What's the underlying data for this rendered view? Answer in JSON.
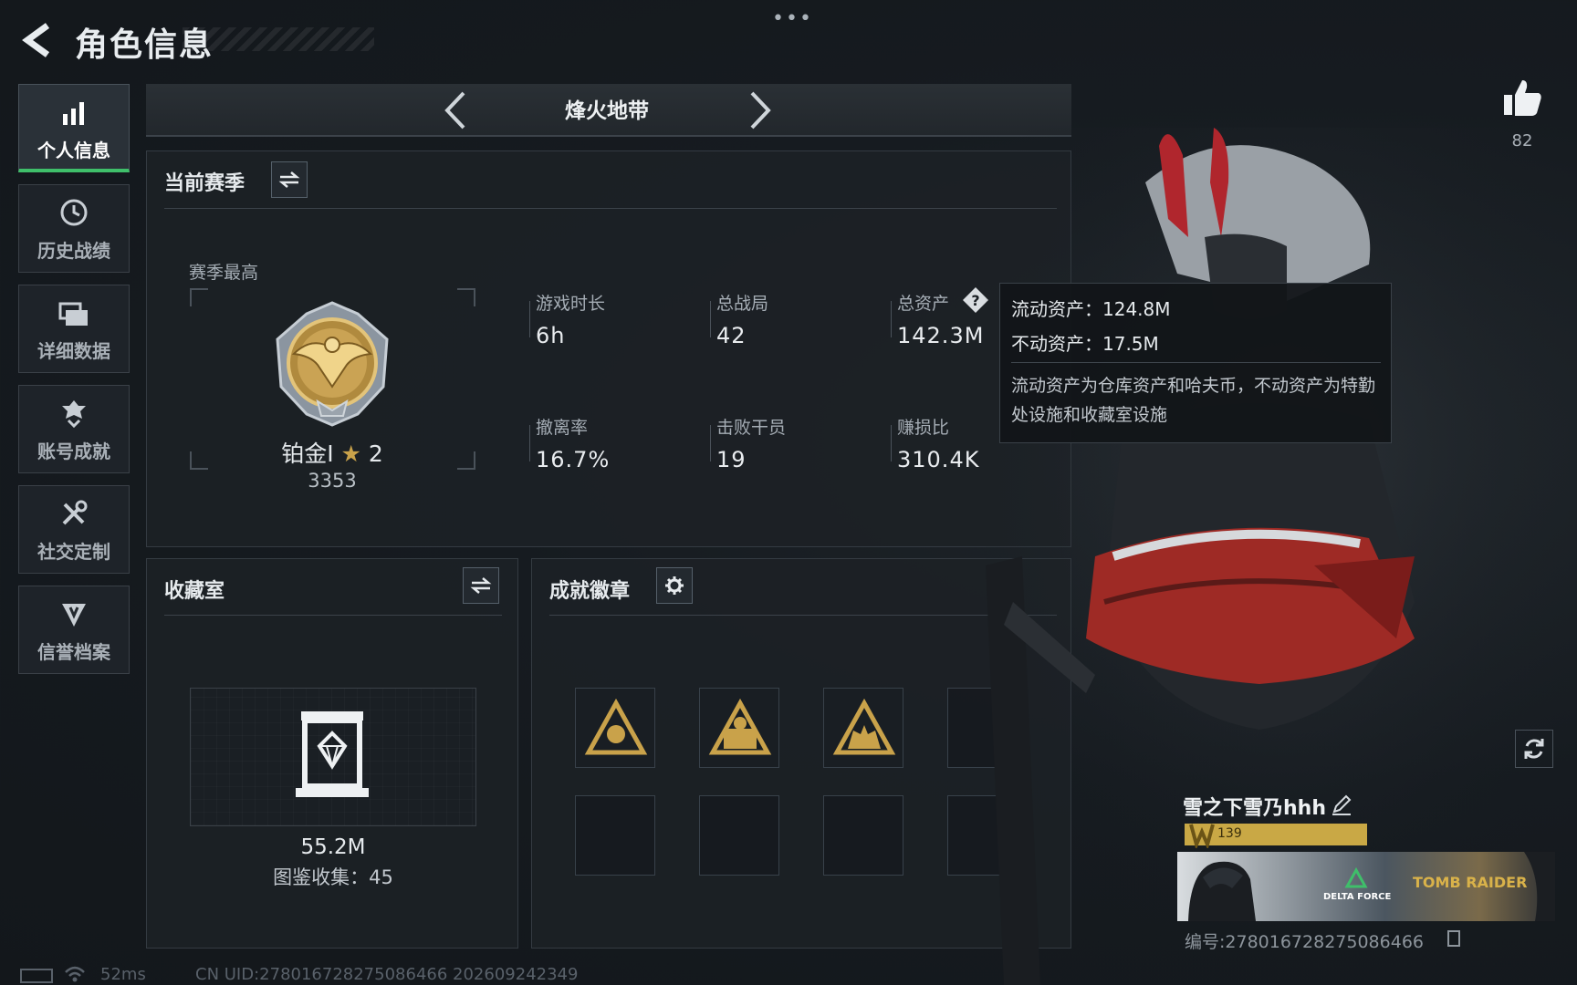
{
  "header": {
    "title": "角色信息",
    "more_label": "•••"
  },
  "sidebar": {
    "items": [
      {
        "label": "个人信息",
        "icon": "bar-chart-icon",
        "active": true
      },
      {
        "label": "历史战绩",
        "icon": "clock-history-icon",
        "active": false
      },
      {
        "label": "详细数据",
        "icon": "folder-icon",
        "active": false
      },
      {
        "label": "账号成就",
        "icon": "medal-icon",
        "active": false
      },
      {
        "label": "社交定制",
        "icon": "tools-icon",
        "active": false
      },
      {
        "label": "信誉档案",
        "icon": "shield-icon",
        "active": false
      }
    ]
  },
  "mode": {
    "title": "烽火地带"
  },
  "season": {
    "title": "当前赛季",
    "best_label": "赛季最高",
    "rank_name": "铂金Ⅰ",
    "rank_stars": "2",
    "rank_score": "3353",
    "stats": [
      {
        "label": "游戏时长",
        "value": "6h"
      },
      {
        "label": "总战局",
        "value": "42"
      },
      {
        "label": "总资产",
        "value": "142.3M"
      },
      {
        "label": "撤离率",
        "value": "16.7%"
      },
      {
        "label": "击败干员",
        "value": "19"
      },
      {
        "label": "赚损比",
        "value": "310.4K"
      }
    ]
  },
  "tooltip": {
    "liquid": "流动资产：124.8M",
    "fixed": "不动资产：17.5M",
    "description": "流动资产为仓库资产和哈夫币，不动资产为特勤处设施和收藏室设施"
  },
  "collection": {
    "title": "收藏室",
    "value": "55.2M",
    "catalog": "图鉴收集：45"
  },
  "achievements": {
    "title": "成就徽章",
    "badge_count_filled": 3
  },
  "profile": {
    "likes": "82",
    "nickname": "雪之下雪乃hhh",
    "level": "139",
    "id_text": "编号:278016728275086466",
    "banner_logo_left": "DELTA FORCE",
    "banner_logo_right": "TOMB RAIDER"
  },
  "status_bar": {
    "ping": "52ms",
    "uid_text": "CN UID:278016728275086466  202609242349"
  },
  "colors": {
    "active_accent": "#3fbf6a",
    "gold": "#c9a24a",
    "level_bar": "#c9a845"
  }
}
